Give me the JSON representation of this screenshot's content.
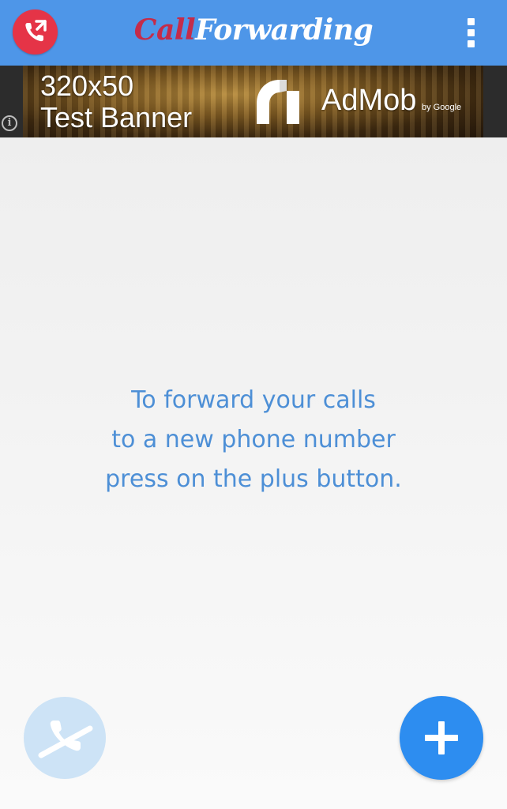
{
  "app_bar": {
    "title_part1": "Call",
    "title_part2": "Forwarding",
    "icon": "phone-forward-icon",
    "menu_icon": "overflow-menu-icon",
    "background_color": "#4e96e8",
    "icon_color": "#e53447"
  },
  "ad": {
    "size_text": "320x50",
    "label_text": "Test Banner",
    "brand": "AdMob",
    "byline": "by Google",
    "info_icon": "info-icon"
  },
  "empty_state": {
    "line1": "To forward your calls",
    "line2": "to a new phone number",
    "line3": "press on the plus button.",
    "text_color": "#4d8fd6"
  },
  "actions": {
    "call_icon": "phone-disabled-icon",
    "add_icon": "plus-icon",
    "add_color": "#2d8df0"
  }
}
